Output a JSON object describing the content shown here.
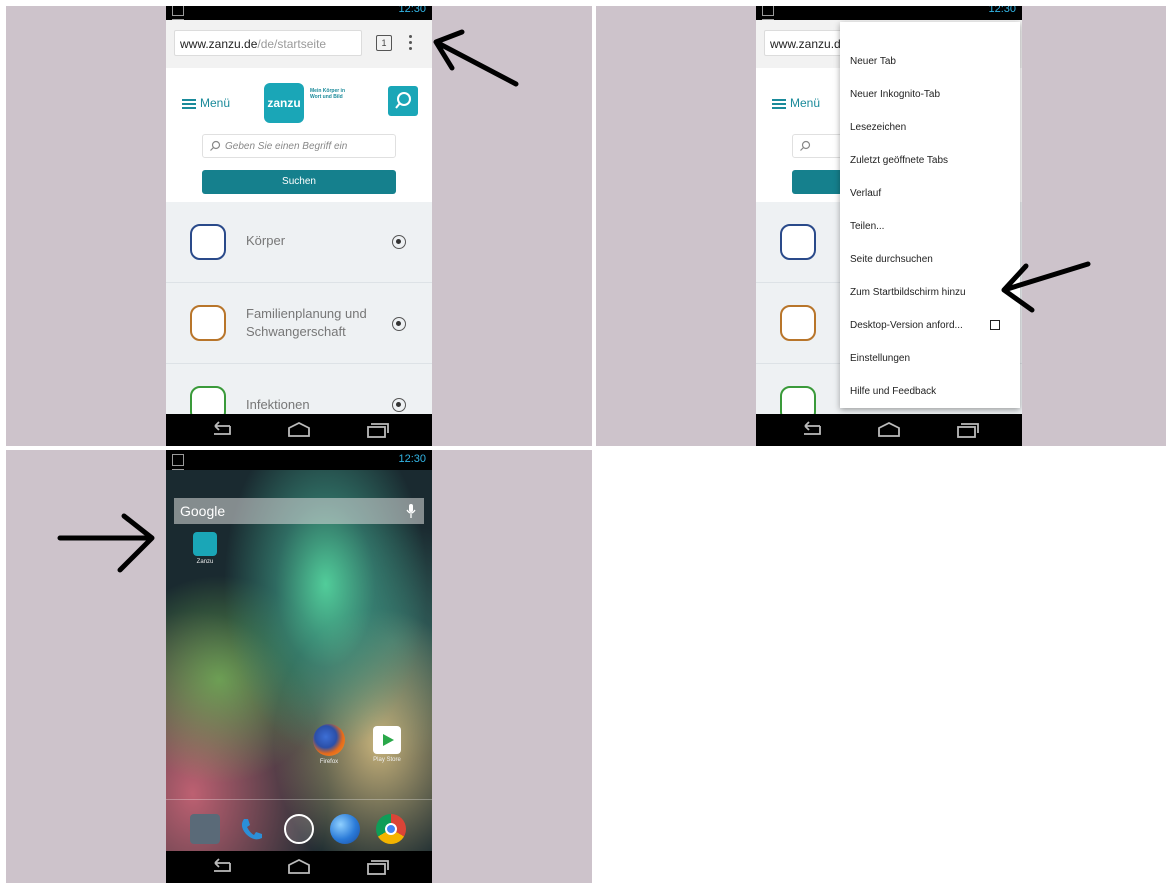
{
  "status": {
    "time": "12:30"
  },
  "browser": {
    "url_domain": "www.zanzu.de",
    "url_path": "/de/startseite",
    "url_domain_short": "www.zanzu.de",
    "tab_count": "1"
  },
  "site": {
    "menu_label": "Menü",
    "logo_text": "zanzu",
    "tagline": "Mein Körper in Wort und Bild",
    "search_placeholder": "Geben Sie einen Begriff ein",
    "search_button": "Suchen",
    "categories": [
      {
        "label": "Körper"
      },
      {
        "label": "Familienplanung und Schwangerschaft"
      },
      {
        "label": "Infektionen"
      }
    ]
  },
  "overflow_menu": {
    "items": [
      "Neuer Tab",
      "Neuer Inkognito-Tab",
      "Lesezeichen",
      "Zuletzt geöffnete Tabs",
      "Verlauf",
      "Teilen...",
      "Seite durchsuchen",
      "Zum Startbildschirm hinzu",
      "Desktop-Version anford...",
      "Einstellungen",
      "Hilfe und Feedback"
    ]
  },
  "home": {
    "search_label": "Google",
    "shortcut_label": "Zanzu",
    "apps": [
      {
        "label": "Firefox"
      },
      {
        "label": "Play Store"
      }
    ]
  },
  "colors": {
    "teal": "#1aa6b7",
    "teal_dark": "#15808d",
    "panel_bg": "#cdc3cb",
    "status_blue": "#33b5e5"
  },
  "icons": [
    "back-icon",
    "home-icon",
    "recents-icon",
    "search-icon",
    "overflow-menu-icon",
    "speaker-icon",
    "mic-icon",
    "arrow-annotation"
  ]
}
